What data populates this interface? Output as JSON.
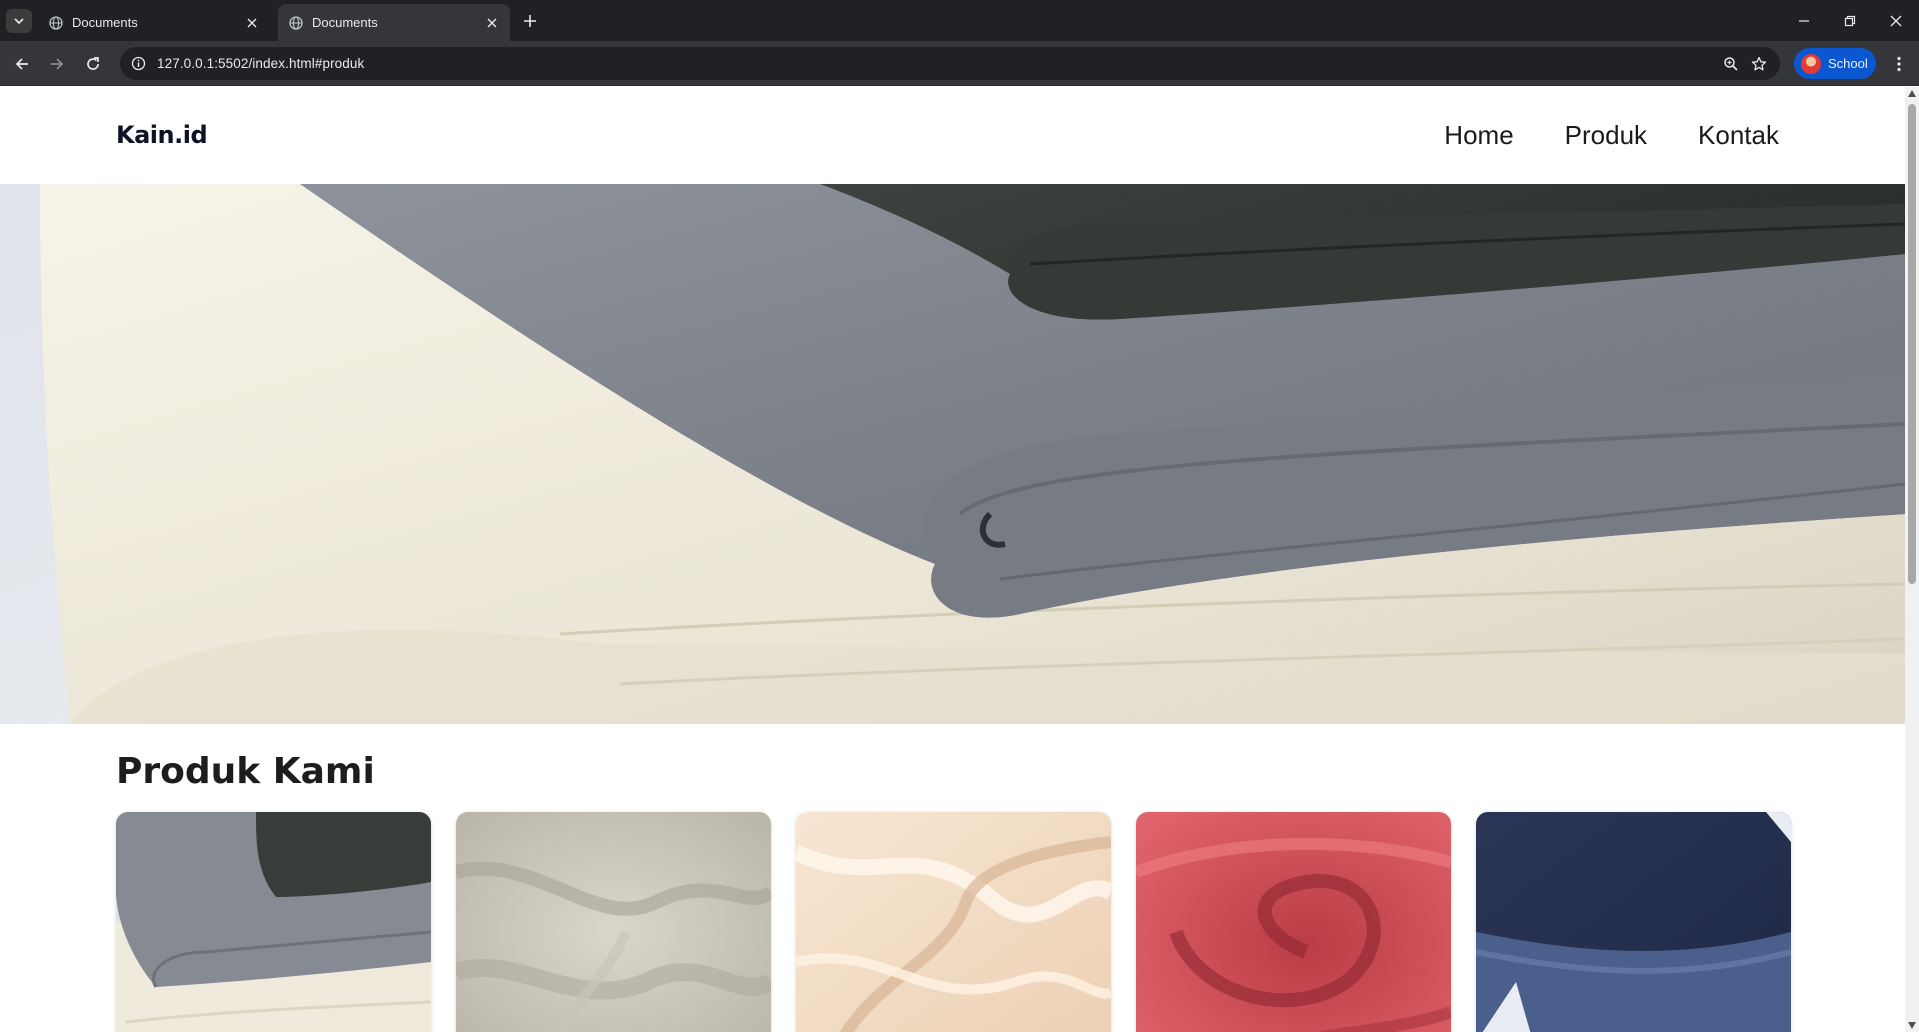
{
  "browser": {
    "tabs": [
      {
        "title": "Documents",
        "active": false
      },
      {
        "title": "Documents",
        "active": true
      }
    ],
    "url": "127.0.0.1:5502/index.html#produk",
    "profile_label": "School",
    "colors": {
      "frame": "#202124",
      "toolbar": "#35363a",
      "profile": "#0b57d0"
    }
  },
  "site": {
    "logo": "Kain.id",
    "nav": [
      "Home",
      "Produk",
      "Kontak"
    ],
    "hero_image": "folded-fabric-stack-photo",
    "products_title": "Produk Kami",
    "products": [
      {
        "image": "folded-cotton-fabric-photo",
        "color": "#8a8f98"
      },
      {
        "image": "linen-fabric-photo",
        "color": "#cfcbbf"
      },
      {
        "image": "satin-fabric-photo",
        "color": "#f3dcc6"
      },
      {
        "image": "red-fabric-photo",
        "color": "#d8545a"
      },
      {
        "image": "denim-fabric-photo",
        "color": "#2c3a5e"
      }
    ]
  }
}
